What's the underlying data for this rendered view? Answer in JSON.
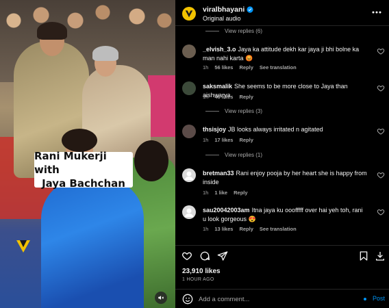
{
  "header": {
    "username": "viralbhayani",
    "subtitle": "Original audio"
  },
  "media": {
    "caption_line1": "Rani Mukerji with",
    "caption_line2": "Jaya Bachchan"
  },
  "comments": [
    {
      "type": "replies",
      "label": "View replies (6)"
    },
    {
      "type": "comment",
      "username": "_elvish_3.o",
      "text": "Jaya ka attitude dekh kar jaya ji bhi bolne ka man nahi karta 😡",
      "time": "1h",
      "likes": "56 likes",
      "reply": "Reply",
      "translate": "See translation",
      "avatar_color": "#6b5e50"
    },
    {
      "type": "comment",
      "username": "saksmalik",
      "text": "She seems to be more close to Jaya than aishwarya",
      "time": "1h",
      "likes": "46 likes",
      "reply": "Reply",
      "translate": "",
      "avatar_color": "#3c4a3a"
    },
    {
      "type": "replies",
      "label": "View replies (3)"
    },
    {
      "type": "comment",
      "username": "thsisjoy",
      "text": "JB looks always irritated n agitated",
      "time": "1h",
      "likes": "17 likes",
      "reply": "Reply",
      "translate": "",
      "avatar_color": "#5b4b48"
    },
    {
      "type": "replies",
      "label": "View replies (1)"
    },
    {
      "type": "comment",
      "username": "bretman33",
      "text": "Rani enjoy pooja by her heart she is happy from inside",
      "time": "1h",
      "likes": "1 like",
      "reply": "Reply",
      "translate": "",
      "avatar_color": "#dbdbdb"
    },
    {
      "type": "comment",
      "username": "sau20042003am",
      "text": "Itna jaya ku ooofffff over hai yeh toh, rani u look gorgeous 😍",
      "time": "1h",
      "likes": "13 likes",
      "reply": "Reply",
      "translate": "See translation",
      "avatar_color": "#dbdbdb"
    }
  ],
  "footer": {
    "likes": "23,910 likes",
    "time_ago": "1 HOUR AGO",
    "comment_placeholder": "Add a comment...",
    "post_label": "Post"
  },
  "colors": {
    "accent": "#0095f6",
    "secondary_text": "#a8a8a8",
    "divider": "#262626"
  }
}
